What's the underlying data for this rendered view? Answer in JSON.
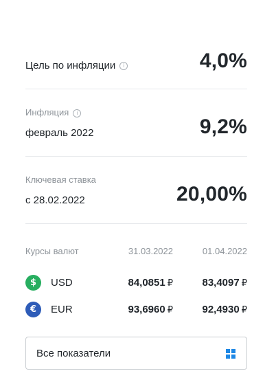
{
  "indicators": [
    {
      "label": "Цель по инфляции",
      "sub": "",
      "value": "4,0%"
    },
    {
      "label": "февраль 2022",
      "sub": "Инфляция",
      "value": "9,2%"
    },
    {
      "label": "с 28.02.2022",
      "sub": "Ключевая ставка",
      "value": "20,00%"
    }
  ],
  "rates": {
    "title": "Курсы валют",
    "date1": "31.03.2022",
    "date2": "01.04.2022",
    "currency_symbol": "₽",
    "rows": [
      {
        "code": "USD",
        "icon": "dollar-icon",
        "glyph": "$",
        "color": "#27ae60",
        "v1": "84,0851",
        "v2": "83,4097"
      },
      {
        "code": "EUR",
        "icon": "euro-icon",
        "glyph": "€",
        "color": "#2e5cb8",
        "v1": "93,6960",
        "v2": "92,4930"
      }
    ]
  },
  "all_button": {
    "label": "Все показатели",
    "icon": "grid-icon",
    "accent": "#1e88e5"
  },
  "info_icon_glyph": "i"
}
